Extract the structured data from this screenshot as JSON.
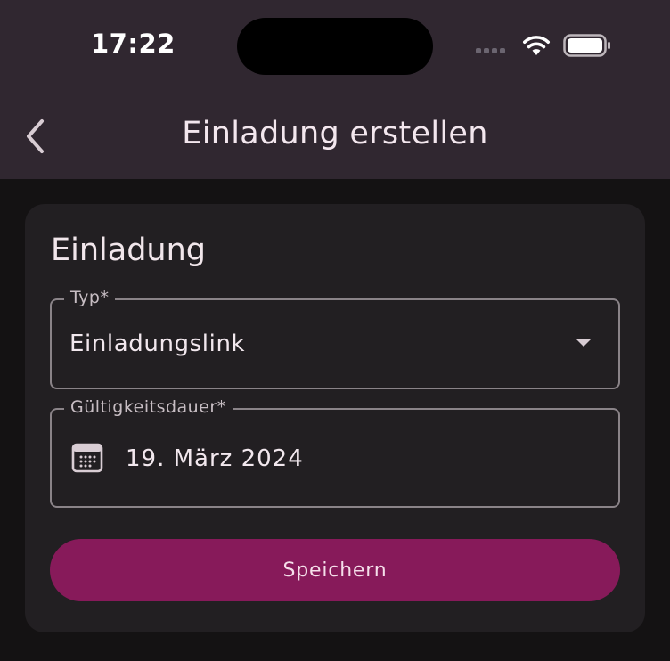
{
  "status_bar": {
    "time": "17:22",
    "icons": [
      "cellular-signal-icon",
      "wifi-icon",
      "battery-icon"
    ]
  },
  "header": {
    "back_icon": "chevron-left-icon",
    "title": "Einladung erstellen"
  },
  "card": {
    "title": "Einladung",
    "type_field": {
      "label": "Typ*",
      "value": "Einladungslink",
      "icon": "dropdown-arrow-icon"
    },
    "validity_field": {
      "label": "Gültigkeitsdauer*",
      "value": "19. März 2024",
      "icon": "calendar-icon"
    },
    "save_label": "Speichern"
  },
  "colors": {
    "appbar_bg": "#302730",
    "page_bg": "#141213",
    "card_bg": "#221f22",
    "primary": "#871a5a",
    "outline": "#8a8388"
  }
}
